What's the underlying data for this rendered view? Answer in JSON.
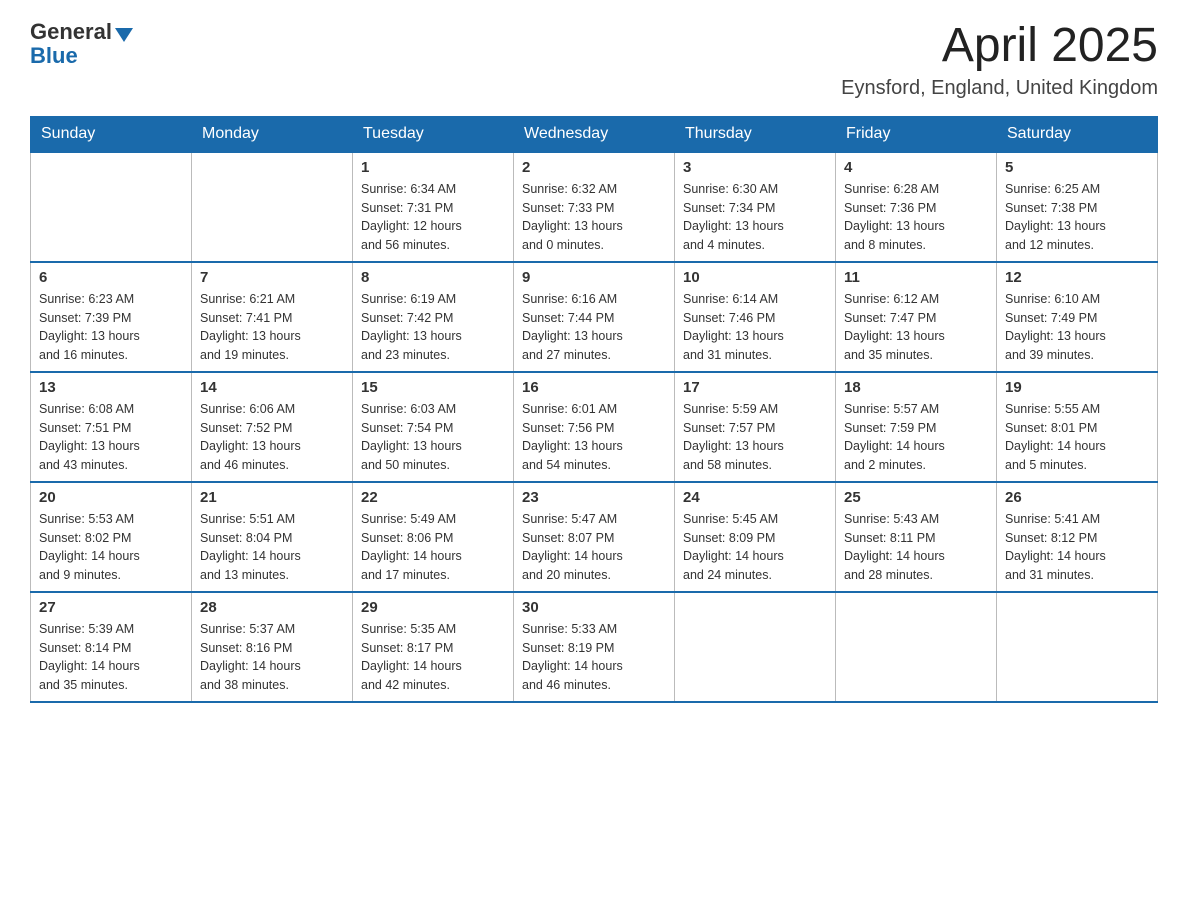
{
  "header": {
    "logo_text_general": "General",
    "logo_text_blue": "Blue",
    "month_title": "April 2025",
    "location": "Eynsford, England, United Kingdom"
  },
  "days_of_week": [
    "Sunday",
    "Monday",
    "Tuesday",
    "Wednesday",
    "Thursday",
    "Friday",
    "Saturday"
  ],
  "weeks": [
    [
      {
        "day": "",
        "info": ""
      },
      {
        "day": "",
        "info": ""
      },
      {
        "day": "1",
        "info": "Sunrise: 6:34 AM\nSunset: 7:31 PM\nDaylight: 12 hours\nand 56 minutes."
      },
      {
        "day": "2",
        "info": "Sunrise: 6:32 AM\nSunset: 7:33 PM\nDaylight: 13 hours\nand 0 minutes."
      },
      {
        "day": "3",
        "info": "Sunrise: 6:30 AM\nSunset: 7:34 PM\nDaylight: 13 hours\nand 4 minutes."
      },
      {
        "day": "4",
        "info": "Sunrise: 6:28 AM\nSunset: 7:36 PM\nDaylight: 13 hours\nand 8 minutes."
      },
      {
        "day": "5",
        "info": "Sunrise: 6:25 AM\nSunset: 7:38 PM\nDaylight: 13 hours\nand 12 minutes."
      }
    ],
    [
      {
        "day": "6",
        "info": "Sunrise: 6:23 AM\nSunset: 7:39 PM\nDaylight: 13 hours\nand 16 minutes."
      },
      {
        "day": "7",
        "info": "Sunrise: 6:21 AM\nSunset: 7:41 PM\nDaylight: 13 hours\nand 19 minutes."
      },
      {
        "day": "8",
        "info": "Sunrise: 6:19 AM\nSunset: 7:42 PM\nDaylight: 13 hours\nand 23 minutes."
      },
      {
        "day": "9",
        "info": "Sunrise: 6:16 AM\nSunset: 7:44 PM\nDaylight: 13 hours\nand 27 minutes."
      },
      {
        "day": "10",
        "info": "Sunrise: 6:14 AM\nSunset: 7:46 PM\nDaylight: 13 hours\nand 31 minutes."
      },
      {
        "day": "11",
        "info": "Sunrise: 6:12 AM\nSunset: 7:47 PM\nDaylight: 13 hours\nand 35 minutes."
      },
      {
        "day": "12",
        "info": "Sunrise: 6:10 AM\nSunset: 7:49 PM\nDaylight: 13 hours\nand 39 minutes."
      }
    ],
    [
      {
        "day": "13",
        "info": "Sunrise: 6:08 AM\nSunset: 7:51 PM\nDaylight: 13 hours\nand 43 minutes."
      },
      {
        "day": "14",
        "info": "Sunrise: 6:06 AM\nSunset: 7:52 PM\nDaylight: 13 hours\nand 46 minutes."
      },
      {
        "day": "15",
        "info": "Sunrise: 6:03 AM\nSunset: 7:54 PM\nDaylight: 13 hours\nand 50 minutes."
      },
      {
        "day": "16",
        "info": "Sunrise: 6:01 AM\nSunset: 7:56 PM\nDaylight: 13 hours\nand 54 minutes."
      },
      {
        "day": "17",
        "info": "Sunrise: 5:59 AM\nSunset: 7:57 PM\nDaylight: 13 hours\nand 58 minutes."
      },
      {
        "day": "18",
        "info": "Sunrise: 5:57 AM\nSunset: 7:59 PM\nDaylight: 14 hours\nand 2 minutes."
      },
      {
        "day": "19",
        "info": "Sunrise: 5:55 AM\nSunset: 8:01 PM\nDaylight: 14 hours\nand 5 minutes."
      }
    ],
    [
      {
        "day": "20",
        "info": "Sunrise: 5:53 AM\nSunset: 8:02 PM\nDaylight: 14 hours\nand 9 minutes."
      },
      {
        "day": "21",
        "info": "Sunrise: 5:51 AM\nSunset: 8:04 PM\nDaylight: 14 hours\nand 13 minutes."
      },
      {
        "day": "22",
        "info": "Sunrise: 5:49 AM\nSunset: 8:06 PM\nDaylight: 14 hours\nand 17 minutes."
      },
      {
        "day": "23",
        "info": "Sunrise: 5:47 AM\nSunset: 8:07 PM\nDaylight: 14 hours\nand 20 minutes."
      },
      {
        "day": "24",
        "info": "Sunrise: 5:45 AM\nSunset: 8:09 PM\nDaylight: 14 hours\nand 24 minutes."
      },
      {
        "day": "25",
        "info": "Sunrise: 5:43 AM\nSunset: 8:11 PM\nDaylight: 14 hours\nand 28 minutes."
      },
      {
        "day": "26",
        "info": "Sunrise: 5:41 AM\nSunset: 8:12 PM\nDaylight: 14 hours\nand 31 minutes."
      }
    ],
    [
      {
        "day": "27",
        "info": "Sunrise: 5:39 AM\nSunset: 8:14 PM\nDaylight: 14 hours\nand 35 minutes."
      },
      {
        "day": "28",
        "info": "Sunrise: 5:37 AM\nSunset: 8:16 PM\nDaylight: 14 hours\nand 38 minutes."
      },
      {
        "day": "29",
        "info": "Sunrise: 5:35 AM\nSunset: 8:17 PM\nDaylight: 14 hours\nand 42 minutes."
      },
      {
        "day": "30",
        "info": "Sunrise: 5:33 AM\nSunset: 8:19 PM\nDaylight: 14 hours\nand 46 minutes."
      },
      {
        "day": "",
        "info": ""
      },
      {
        "day": "",
        "info": ""
      },
      {
        "day": "",
        "info": ""
      }
    ]
  ]
}
